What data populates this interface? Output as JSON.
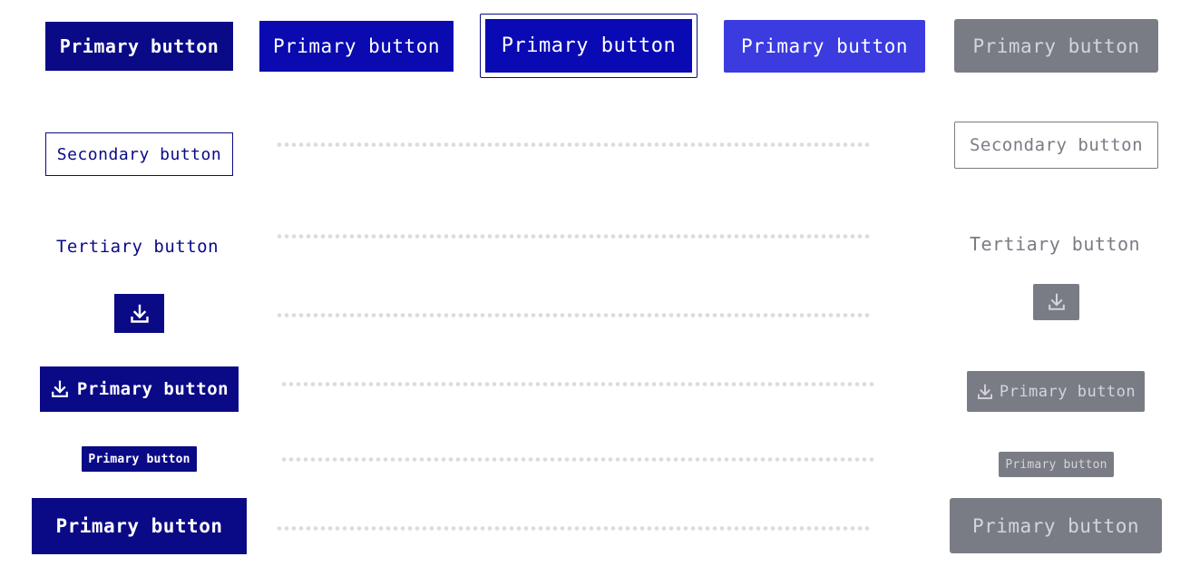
{
  "colors": {
    "primary_default": "#0a0a87",
    "primary_hover": "#0a0ab0",
    "primary_pressed": "#0a0ab4",
    "primary_focus_ring": "#0a0a87",
    "primary_active": "#3b3be0",
    "disabled": "#7a7c85",
    "disabled_text": "#d4d5db",
    "secondary_text": "#0a0a87",
    "disabled_outline": "#7a7c85",
    "placeholder_dots": "#dcdcdc"
  },
  "row_primary": {
    "default_label": "Primary button",
    "hover_label": "Primary button",
    "focus_label": "Primary button",
    "active_label": "Primary button",
    "disabled_label": "Primary button"
  },
  "row_secondary": {
    "default_label": "Secondary button",
    "disabled_label": "Secondary button"
  },
  "row_tertiary": {
    "default_label": "Tertiary button",
    "disabled_label": "Tertiary button"
  },
  "row_icon_only": {
    "icon": "download-icon"
  },
  "row_icon_label": {
    "default_label": "Primary button",
    "disabled_label": "Primary button",
    "icon": "download-icon"
  },
  "row_small": {
    "default_label": "Primary button",
    "disabled_label": "Primary button"
  },
  "row_large": {
    "default_label": "Primary button",
    "disabled_label": "Primary button"
  }
}
